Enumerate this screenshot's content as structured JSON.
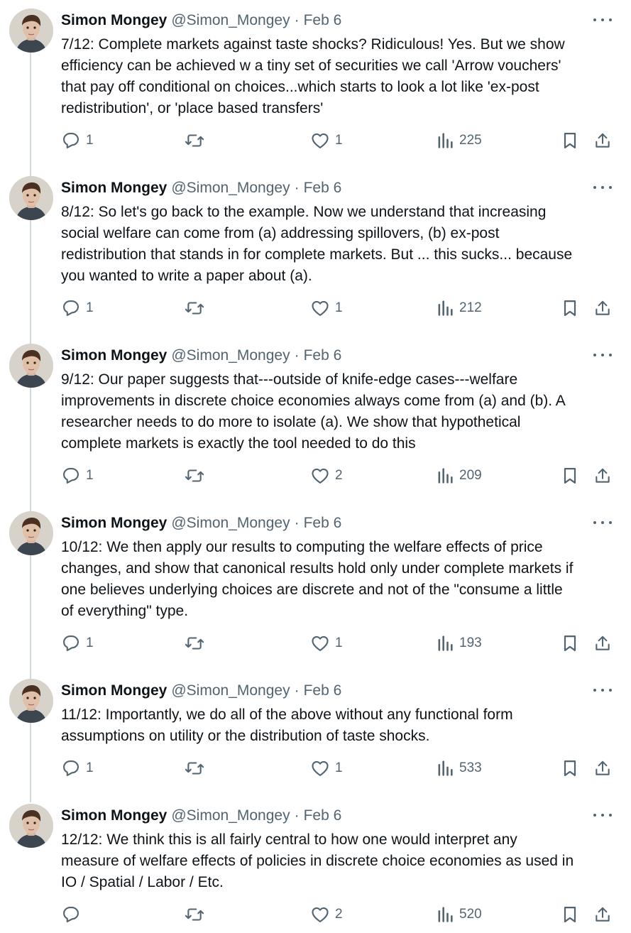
{
  "tweets": [
    {
      "name": "Simon Mongey",
      "handle": "@Simon_Mongey",
      "separator": "·",
      "date": "Feb 6",
      "text": "7/12: Complete markets against taste shocks? Ridiculous!  Yes. But we show\nefficiency can be achieved w a tiny set of securities we call 'Arrow vouchers'\nthat pay off conditional on choices...which starts to look a lot like 'ex-post\nredistribution', or 'place based transfers'",
      "replies": "1",
      "reposts": "",
      "likes": "1",
      "views": "225"
    },
    {
      "name": "Simon Mongey",
      "handle": "@Simon_Mongey",
      "separator": "·",
      "date": "Feb 6",
      "text": "8/12: So let's go back to the example. Now we understand that increasing\nsocial welfare can come from (a) addressing spillovers, (b) ex-post\nredistribution that stands in for complete markets. But ... this sucks... because\nyou wanted to write a paper about (a).",
      "replies": "1",
      "reposts": "",
      "likes": "1",
      "views": "212"
    },
    {
      "name": "Simon Mongey",
      "handle": "@Simon_Mongey",
      "separator": "·",
      "date": "Feb 6",
      "text": "9/12: Our paper suggests that---outside of knife-edge cases---welfare\nimprovements in discrete choice economies always come from (a) and (b). A\nresearcher needs to do more to isolate (a). We show that hypothetical\ncomplete markets is exactly the  tool needed to do this",
      "replies": "1",
      "reposts": "",
      "likes": "2",
      "views": "209"
    },
    {
      "name": "Simon Mongey",
      "handle": "@Simon_Mongey",
      "separator": "·",
      "date": "Feb 6",
      "text": "10/12: We then apply our results to computing the welfare effects of price\nchanges, and show that canonical results hold only under complete markets if\none believes underlying choices are discrete and not of the \"consume a little\nof everything\" type.",
      "replies": "1",
      "reposts": "",
      "likes": "1",
      "views": "193"
    },
    {
      "name": "Simon Mongey",
      "handle": "@Simon_Mongey",
      "separator": "·",
      "date": "Feb 6",
      "text": "11/12: Importantly, we do all of the above without any functional form\nassumptions on utility or the distribution of taste shocks.",
      "replies": "1",
      "reposts": "",
      "likes": "1",
      "views": "533"
    },
    {
      "name": "Simon Mongey",
      "handle": "@Simon_Mongey",
      "separator": "·",
      "date": "Feb 6",
      "text": "12/12: We think this is all fairly central to how one would interpret any\nmeasure of welfare effects of policies in discrete choice economies as used in\nIO / Spatial / Labor / Etc.",
      "replies": "",
      "reposts": "",
      "likes": "2",
      "views": "520"
    }
  ],
  "icons": {
    "reply": "reply-icon",
    "repost": "repost-icon",
    "like": "heart-icon",
    "views": "views-icon",
    "bookmark": "bookmark-icon",
    "share": "share-icon",
    "more": "more-icon"
  },
  "colors": {
    "text": "#0f1419",
    "secondary": "#536471",
    "thread_line": "#cfd9de"
  }
}
